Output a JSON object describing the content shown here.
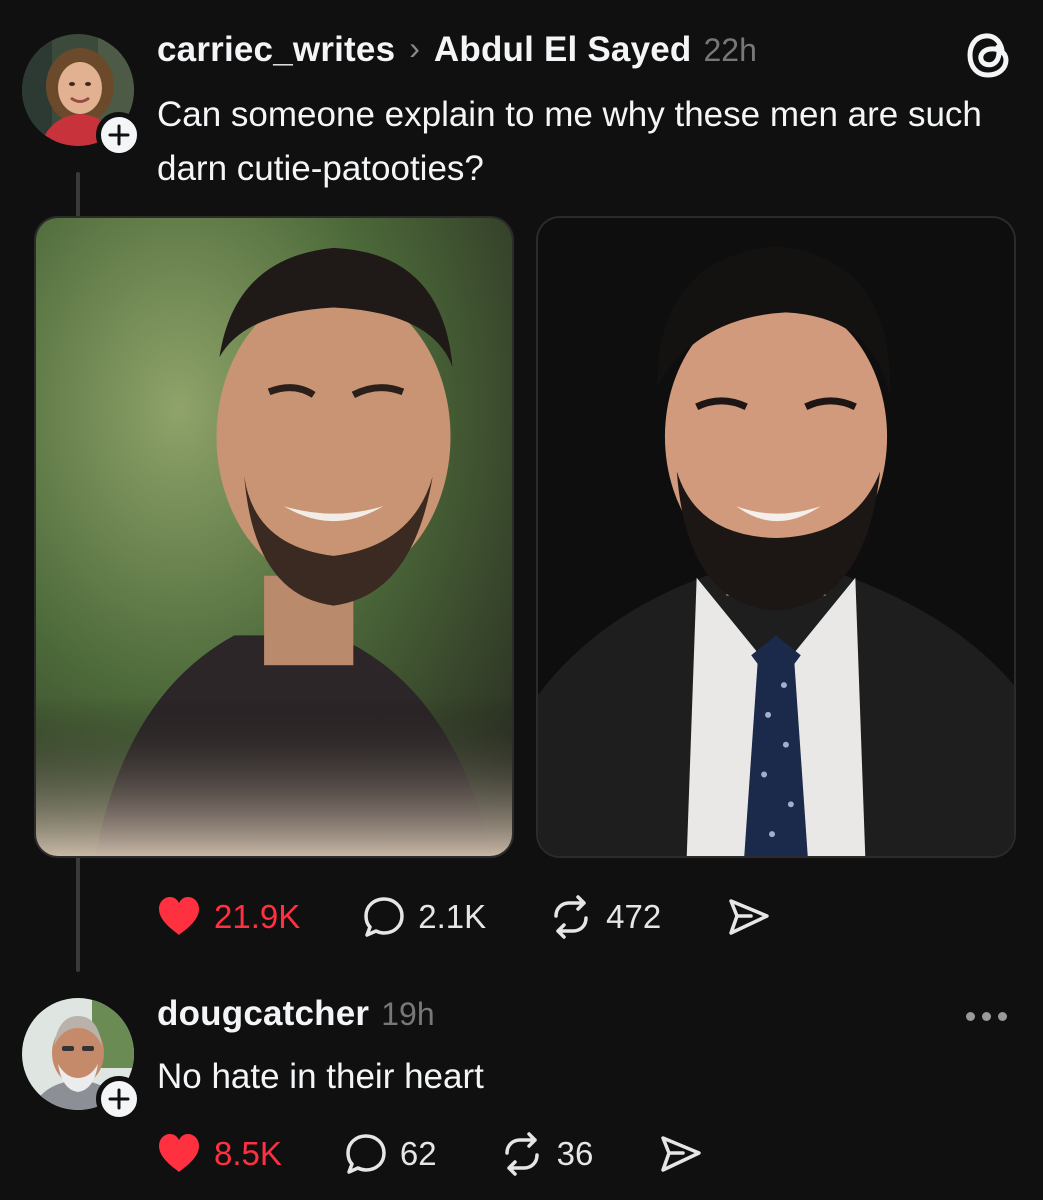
{
  "post": {
    "author": "carriec_writes",
    "reply_to": "Abdul El Sayed",
    "time": "22h",
    "text": "Can someone explain to me why these men are such darn cutie-patooties?",
    "stats": {
      "likes": "21.9K",
      "replies": "2.1K",
      "reposts": "472"
    }
  },
  "reply": {
    "author": "dougcatcher",
    "time": "19h",
    "text": "No hate in their heart",
    "stats": {
      "likes": "8.5K",
      "replies": "62",
      "reposts": "36"
    }
  },
  "icons": {
    "like": "heart-icon",
    "reply": "speech-bubble-icon",
    "repost": "repost-icon",
    "share": "send-icon",
    "app_logo": "threads-logo-icon",
    "follow": "plus-icon",
    "more": "more-dots-icon"
  },
  "colors": {
    "background": "#101010",
    "text": "#f3f5f7",
    "secondary": "#777777",
    "like_red": "#ff3040"
  }
}
